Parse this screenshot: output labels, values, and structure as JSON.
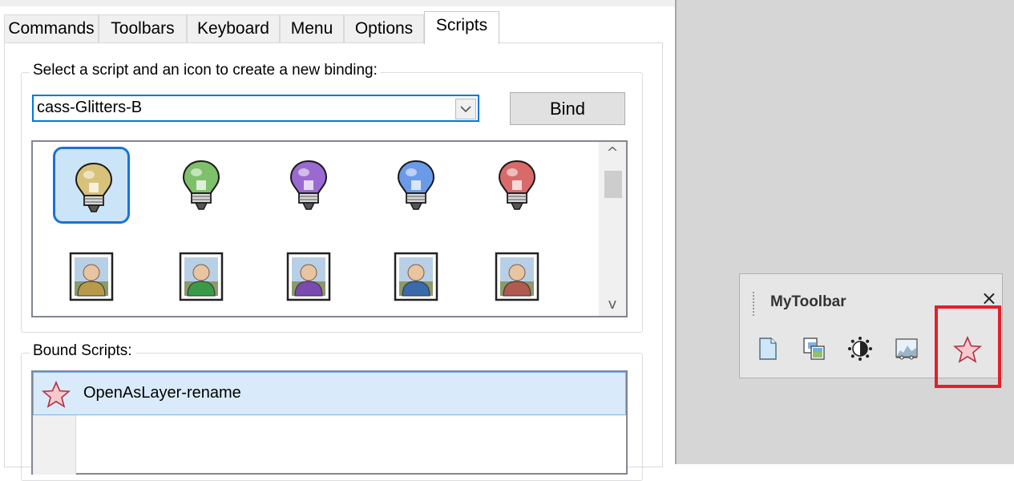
{
  "tabs": [
    {
      "label": "Commands",
      "active": false
    },
    {
      "label": "Toolbars",
      "active": false
    },
    {
      "label": "Keyboard",
      "active": false
    },
    {
      "label": "Menu",
      "active": false
    },
    {
      "label": "Options",
      "active": false
    },
    {
      "label": "Scripts",
      "active": true
    }
  ],
  "select_group": {
    "legend": "Select a script and an icon to create a new binding:",
    "script_value": "cass-Glitters-B",
    "bind_label": "Bind"
  },
  "icon_grid": {
    "bulb_colors": [
      "#d8c27a",
      "#7fc06a",
      "#9a6ad0",
      "#6a9ae8",
      "#d86a6a"
    ],
    "person_colors": [
      "#b89a4a",
      "#3a9a4a",
      "#7a4ab0",
      "#3a6aaa",
      "#b05a50"
    ],
    "selected_index": 0,
    "scroll_up_glyph": "^",
    "scroll_down_glyph": "v"
  },
  "bound_group": {
    "legend": "Bound Scripts:",
    "items": [
      {
        "label": "OpenAsLayer-rename",
        "icon": "star-icon"
      }
    ]
  },
  "toolbar": {
    "title": "MyToolbar",
    "close_glyph": "×",
    "buttons": [
      "new-document-icon",
      "copy-images-icon",
      "brightness-icon",
      "image-levels-icon",
      "star-icon"
    ],
    "highlight_color": "#e0202a"
  }
}
